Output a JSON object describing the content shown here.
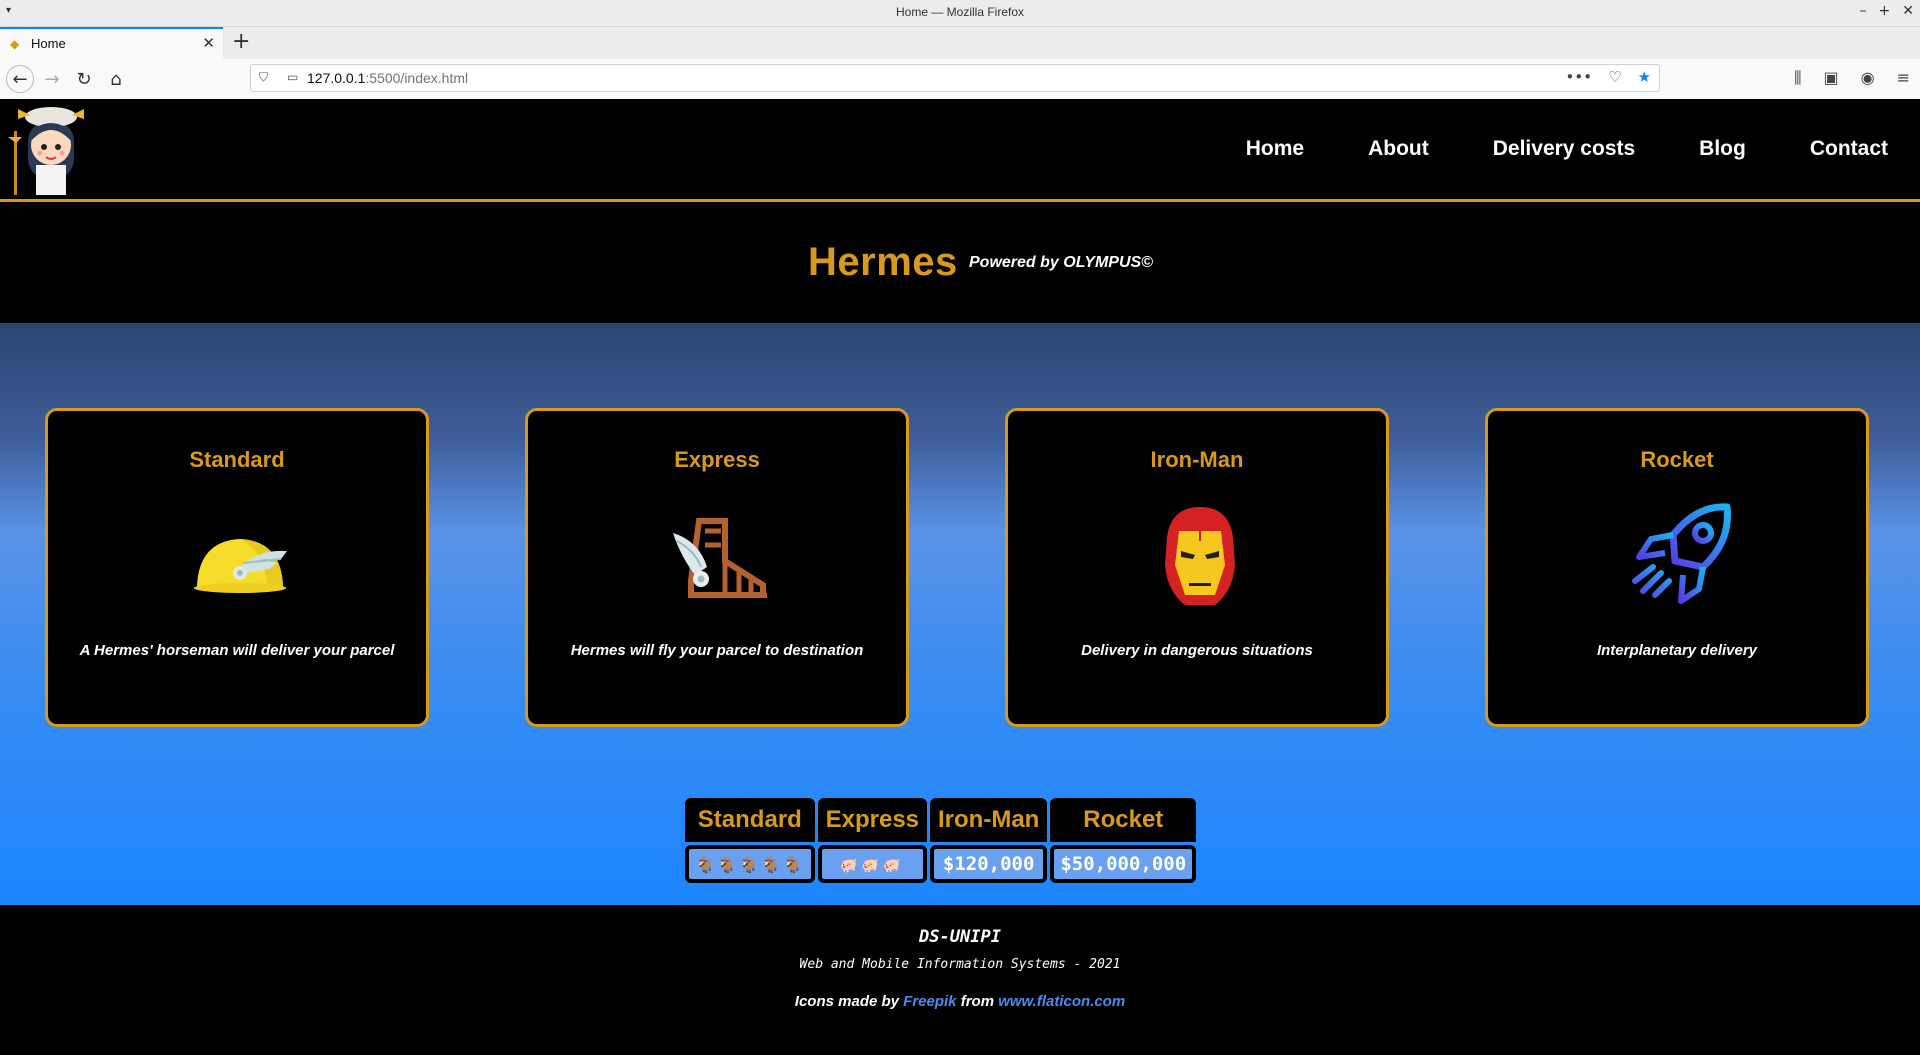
{
  "browser": {
    "window_title": "Home — Mozilla Firefox",
    "tab_title": "Home",
    "url_host": "127.0.0.1",
    "url_rest": ":5500/index.html"
  },
  "nav": {
    "items": [
      "Home",
      "About",
      "Delivery costs",
      "Blog",
      "Contact"
    ]
  },
  "hero": {
    "title": "Hermes",
    "powered": "Powered by OLYMPUS©"
  },
  "cards": [
    {
      "title": "Standard",
      "desc": "A Hermes' horseman will deliver your parcel",
      "icon": "winged-helmet-icon"
    },
    {
      "title": "Express",
      "desc": "Hermes will fly your parcel to destination",
      "icon": "winged-sandal-icon"
    },
    {
      "title": "Iron-Man",
      "desc": "Delivery in dangerous situations",
      "icon": "iron-man-mask-icon"
    },
    {
      "title": "Rocket",
      "desc": "Interplanetary delivery",
      "icon": "rocket-icon"
    }
  ],
  "prices": {
    "headers": [
      "Standard",
      "Express",
      "Iron-Man",
      "Rocket"
    ],
    "standard": "🐐🐐🐐🐐🐐",
    "express": "🐖🐖🐖",
    "ironman": "$120,000",
    "rocket": "$50,000,000"
  },
  "footer": {
    "org": "DS-UNIPI",
    "course": "Web and Mobile Information Systems - 2021",
    "credit_prefix": "Icons made by",
    "credit_author": "Freepik",
    "credit_from": "from",
    "credit_site": "www.flaticon.com"
  },
  "colors": {
    "accent": "#d99a1c",
    "link": "#4a8cf0"
  }
}
